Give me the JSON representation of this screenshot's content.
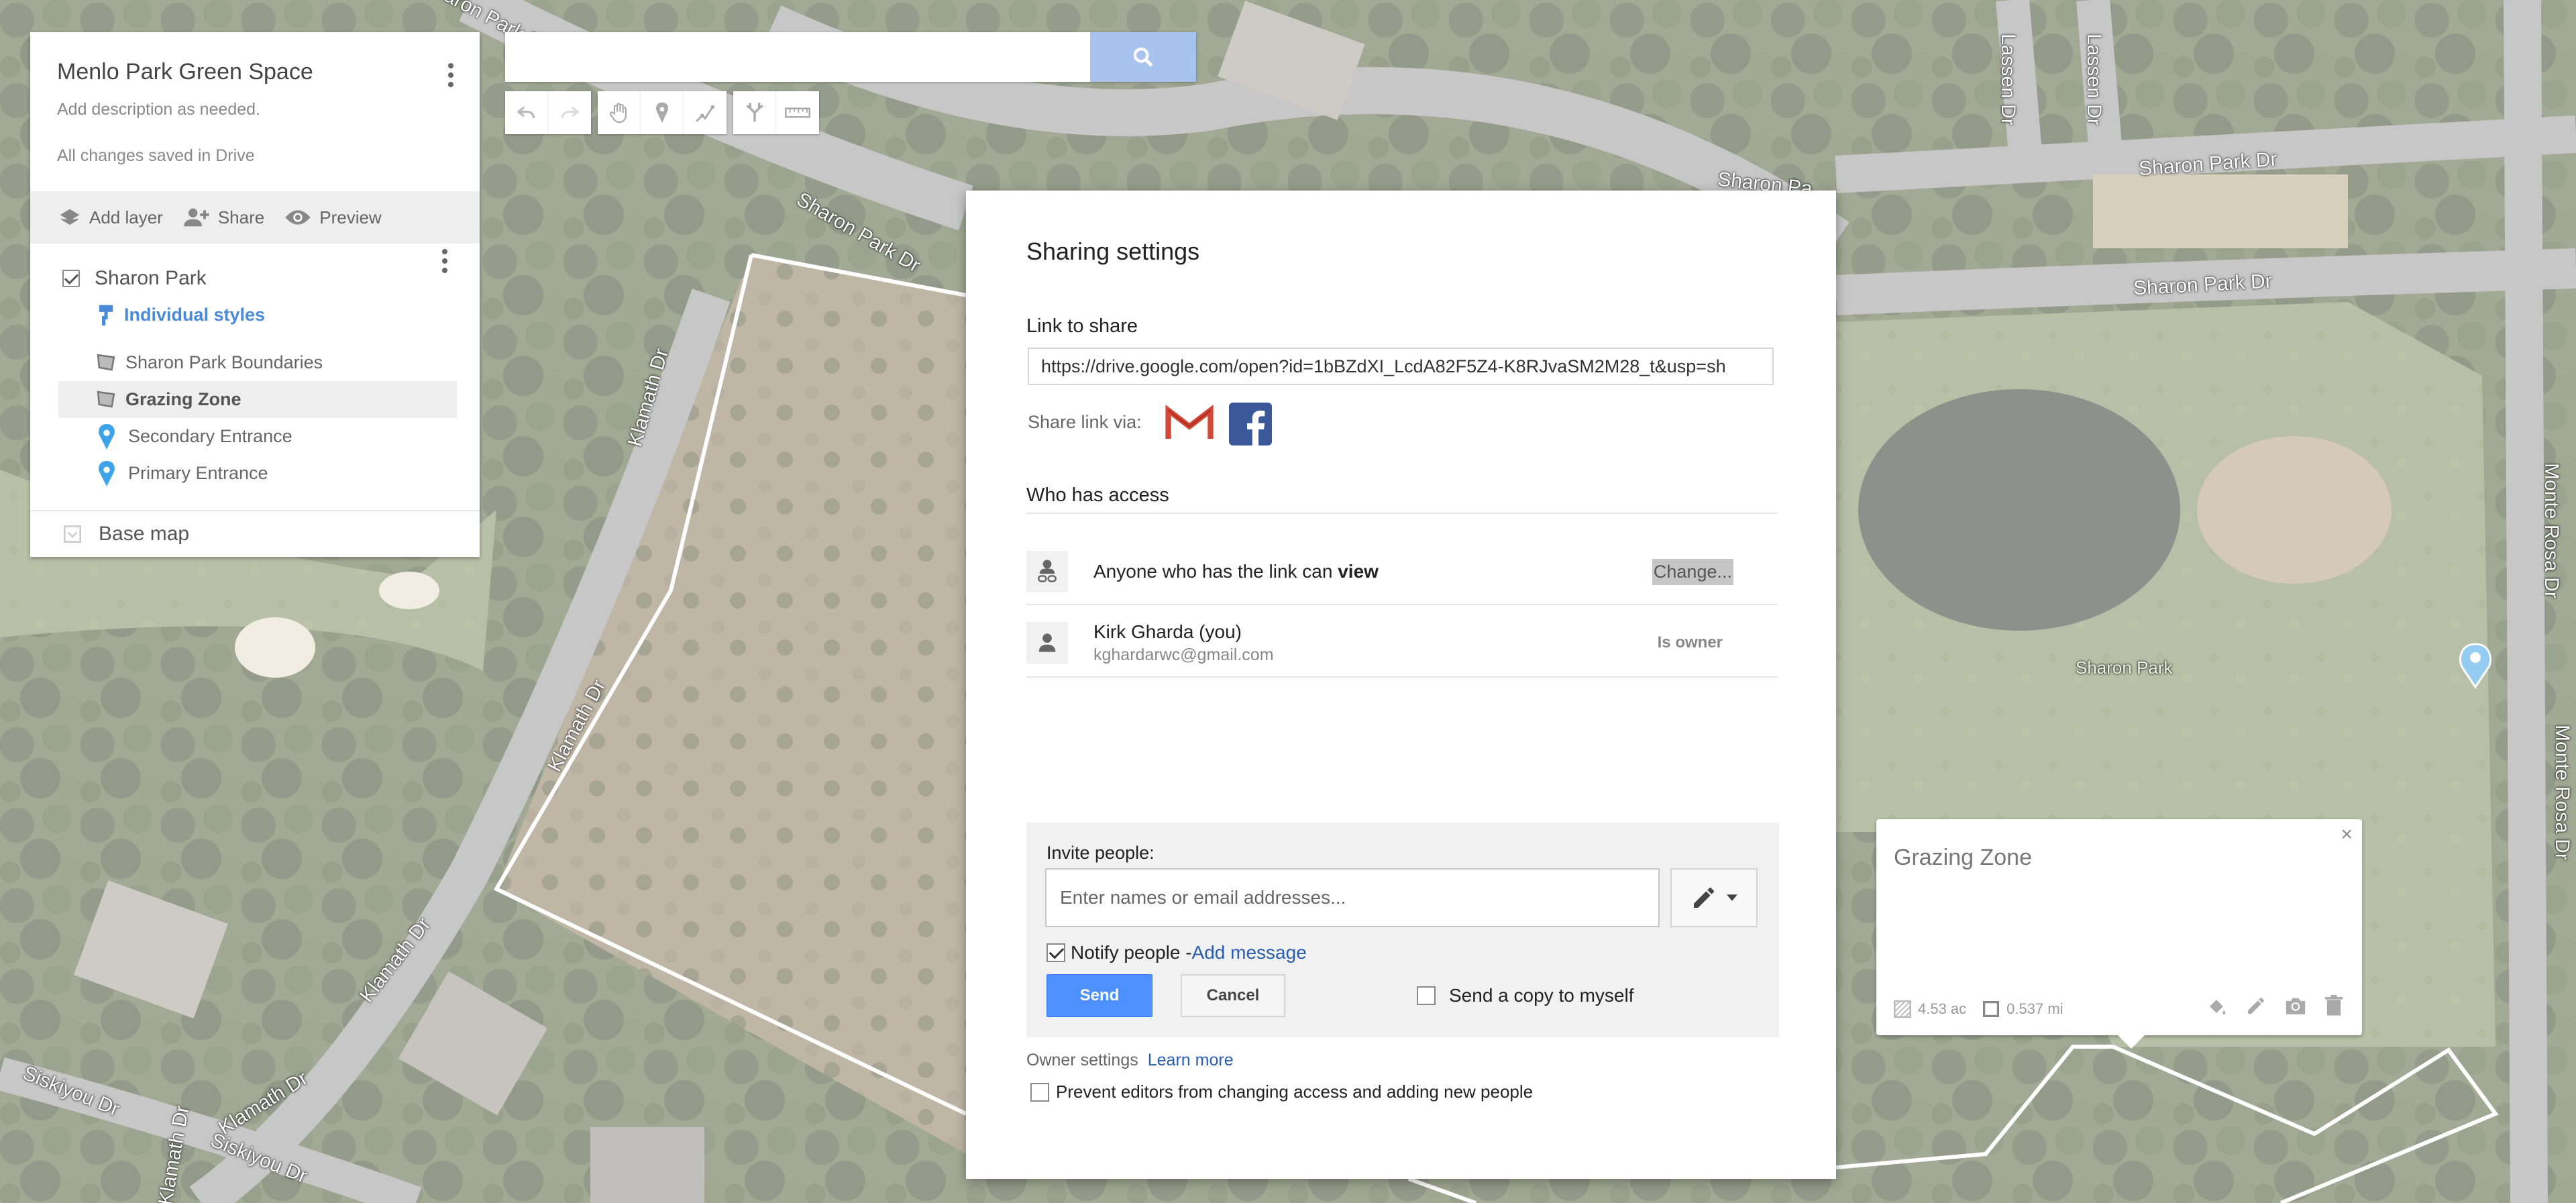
{
  "map": {
    "labels": [
      "Sharon Park Dr",
      "Sharon Park Dr",
      "Sharon Park Dr",
      "Sharon Park Dr",
      "Sharon Park",
      "Klamath Dr",
      "Klamath Dr",
      "Klamath Dr",
      "Klamath Dr",
      "Klamath Dr",
      "Siskiyou Dr",
      "Siskiyou Dr",
      "Lassen Dr",
      "Lassen Dr",
      "Monte Rosa Dr",
      "Monte Rosa Dr",
      "Sharon Pa"
    ]
  },
  "left_panel": {
    "title": "Menlo Park Green Space",
    "description": "Add description as needed.",
    "saved_status": "All changes saved in Drive",
    "actions": {
      "add_layer": "Add layer",
      "share": "Share",
      "preview": "Preview"
    },
    "layer": {
      "name": "Sharon Park",
      "style": "Individual styles",
      "features": [
        {
          "label": "Sharon Park Boundaries",
          "icon": "polygon-icon"
        },
        {
          "label": "Grazing Zone",
          "icon": "polygon-icon"
        },
        {
          "label": "Secondary Entrance",
          "icon": "map-pin-icon"
        },
        {
          "label": "Primary Entrance",
          "icon": "map-pin-icon"
        }
      ]
    },
    "base_map": "Base map"
  },
  "search": {
    "placeholder": ""
  },
  "dialog": {
    "title": "Sharing settings",
    "link_label": "Link to share",
    "link_url": "https://drive.google.com/open?id=1bBZdXI_LcdA82F5Z4-K8RJvaSM2M28_t&usp=sh",
    "share_via_label": "Share link via:",
    "who_has_access": "Who has access",
    "access_rows": [
      {
        "text_prefix": "Anyone who has the link can ",
        "text_bold": "view",
        "action": "Change..."
      },
      {
        "name": "Kirk Gharda (you)",
        "email": "kghardarwc@gmail.com",
        "role": "Is owner"
      }
    ],
    "invite": {
      "label": "Invite people:",
      "placeholder": "Enter names or email addresses...",
      "notify_label": "Notify people - ",
      "add_message": "Add message",
      "send": "Send",
      "cancel": "Cancel",
      "copy_self": "Send a copy to myself"
    },
    "owner_settings": "Owner settings",
    "learn_more": "Learn more",
    "prevent_editors": "Prevent editors from changing access and adding new people"
  },
  "info_window": {
    "title": "Grazing Zone",
    "area": "4.53 ac",
    "perimeter": "0.537 mi",
    "close": "×"
  },
  "colors": {
    "accent_blue": "#4d90fe",
    "link_blue": "#2a5db0",
    "style_blue": "#4a8ad8",
    "gmail_red": "#d44638",
    "facebook_blue": "#3b5998",
    "pin_blue": "#3ea3e8"
  }
}
